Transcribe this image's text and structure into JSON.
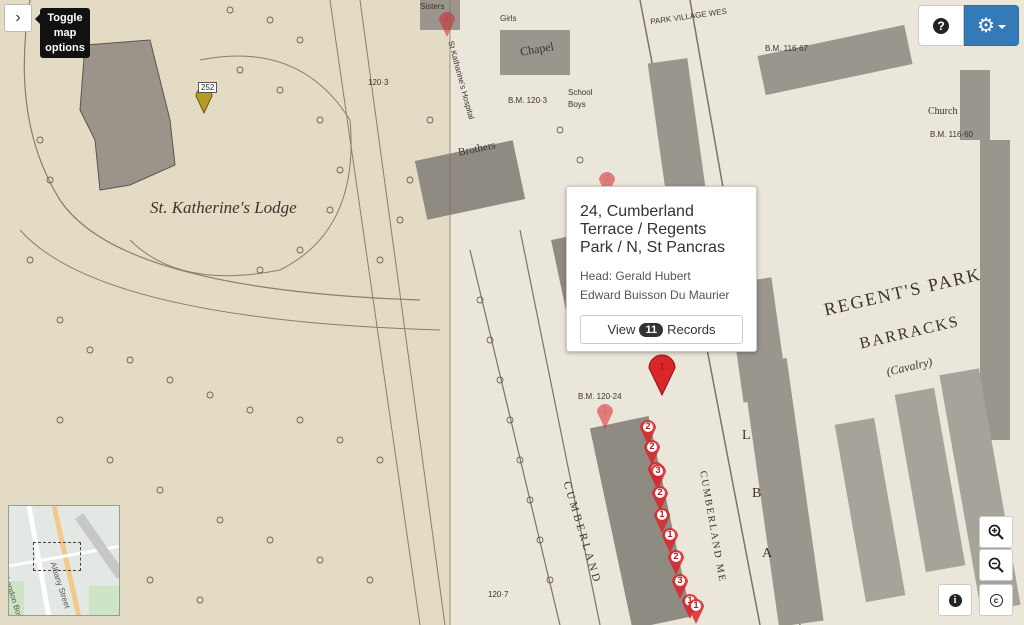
{
  "map": {
    "labels": {
      "lodge": "St. Katherine's Lodge",
      "barracks_line1": "REGENT'S PARK",
      "barracks_line2": "BARRACKS",
      "cavalry": "(Cavalry)",
      "chapel": "Chapel",
      "brothers": "Brothers",
      "church": "Church",
      "cumberland_terrace": "CUMBERLAND",
      "cumberland_mews": "CUMBERLAND ME",
      "lba_l": "L",
      "lba_b": "B",
      "lba_a": "A",
      "park_village": "PARK VILLAGE WES",
      "bm1": "B.M. 120·3",
      "bm2": "B.M. 116·67",
      "bm3": "B.M. 116·60",
      "bm4": "120·3",
      "bm5": "B.M. 120·24",
      "bm6": "120·7",
      "sisters": "Sisters",
      "school": "School",
      "girls": "Girls",
      "boys": "Boys",
      "hospital": "St Katharine's Hospital"
    },
    "layer_a_tint": "#e3dbc3",
    "layer_b_tint": "#ebe6da"
  },
  "markers": [
    {
      "id": "m1",
      "count": "1",
      "variant": "ghost"
    },
    {
      "id": "m2",
      "count": "2",
      "variant": "ghost"
    },
    {
      "id": "m3",
      "count": "1",
      "variant": "selected"
    },
    {
      "id": "m4",
      "count": "1",
      "variant": "ghost"
    },
    {
      "id": "m5",
      "count": "2",
      "variant": "normal"
    },
    {
      "id": "m6",
      "count": "2",
      "variant": "normal"
    },
    {
      "id": "m7",
      "count": "2",
      "variant": "normal"
    },
    {
      "id": "m8",
      "count": "3",
      "variant": "normal"
    },
    {
      "id": "m9",
      "count": "2",
      "variant": "normal"
    },
    {
      "id": "m10",
      "count": "1",
      "variant": "normal"
    },
    {
      "id": "m11",
      "count": "1",
      "variant": "normal"
    },
    {
      "id": "m12",
      "count": "2",
      "variant": "normal"
    },
    {
      "id": "m13",
      "count": "3",
      "variant": "normal"
    },
    {
      "id": "m14",
      "count": "1",
      "variant": "normal"
    },
    {
      "id": "m15",
      "count": "1",
      "variant": "normal"
    }
  ],
  "yellow_marker": {
    "tag": "252"
  },
  "popup": {
    "title": "24, Cumberland Terrace / Regents Park / N, St Pancras",
    "head_line1": "Head: Gerald Hubert",
    "head_line2": "Edward Buisson Du Maurier",
    "button_prefix": "View",
    "record_count": "11",
    "button_suffix": "Records"
  },
  "controls": {
    "toggle_icon": "chevron-right-icon",
    "toggle_glyph": "›",
    "tooltip": "Toggle map options",
    "help_glyph": "?",
    "settings_glyph": "⚙",
    "zoom_in_icon": "zoom-in-icon",
    "zoom_out_icon": "zoom-out-icon",
    "info_glyph": "i",
    "copyright_glyph": "c"
  },
  "minimap": {
    "street1": "London Borough of C",
    "street2": "Albany Street"
  },
  "colors": {
    "marker_red": "#d9262b",
    "settings_blue": "#337ab7",
    "yellow_marker": "#b59a24"
  }
}
